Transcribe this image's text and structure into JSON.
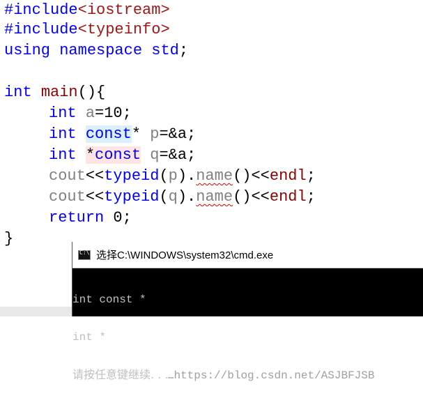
{
  "code": {
    "include1": {
      "directive": "#include",
      "header": "<iostream>"
    },
    "include2": {
      "directive": "#include",
      "header": "<typeinfo>"
    },
    "using": {
      "kw1": "using",
      "kw2": "namespace",
      "ns": "std",
      "semi": ";"
    },
    "main_sig": {
      "type": "int",
      "name": "main",
      "rest": "(){"
    },
    "decl_a": {
      "type": "int",
      "name": "a",
      "rest": "=10;"
    },
    "decl_p": {
      "type": "int",
      "qual": "const",
      "star": "*",
      "name": "p",
      "rest": "=&a;"
    },
    "decl_q": {
      "type": "int",
      "star": "*",
      "qual": "const",
      "name": "q",
      "rest": "=&a;"
    },
    "cout_p": {
      "obj": "cout",
      "op": "<<",
      "fn": "typeid",
      "open": "(",
      "arg": "p",
      "close": ").",
      "method": "name",
      "call": "()",
      "op2": "<<",
      "endl": "endl",
      "semi": ";"
    },
    "cout_q": {
      "obj": "cout",
      "op": "<<",
      "fn": "typeid",
      "open": "(",
      "arg": "q",
      "close": ").",
      "method": "name",
      "call": "()",
      "op2": "<<",
      "endl": "endl",
      "semi": ";"
    },
    "ret": {
      "kw": "return",
      "val": "0",
      "semi": ";"
    },
    "close_brace": "}"
  },
  "console": {
    "title": "选择C:\\WINDOWS\\system32\\cmd.exe",
    "icon": "cmd-window-icon",
    "output_lines": [
      "int const *",
      "int *"
    ],
    "prompt": "请按任意键继续. . .",
    "watermark": "https://blog.csdn.net/ASJBFJSB"
  }
}
